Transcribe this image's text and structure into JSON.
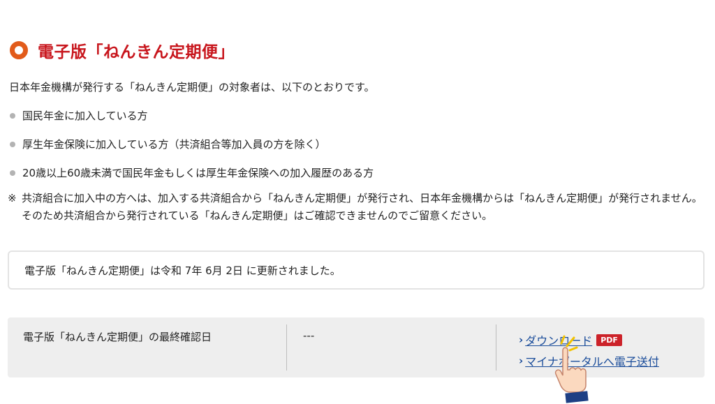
{
  "section": {
    "title": "電子版「ねんきん定期便」"
  },
  "intro": "日本年金機構が発行する「ねんきん定期便」の対象者は、以下のとおりです。",
  "bullets": [
    "国民年金に加入している方",
    "厚生年金保険に加入している方（共済組合等加入員の方を除く）",
    "20歳以上60歳未満で国民年金もしくは厚生年金保険への加入履歴のある方"
  ],
  "note": {
    "mark": "※",
    "text": "共済組合に加入中の方へは、加入する共済組合から「ねんきん定期便」が発行され、日本年金機構からは「ねんきん定期便」が発行されません。そのため共済組合から発行されている「ねんきん定期便」はご確認できませんのでご留意ください。"
  },
  "update_notice": "電子版「ねんきん定期便」は令和 7年 6月 2日 に更新されました。",
  "info_panel": {
    "label": "電子版「ねんきん定期便」の最終確認日",
    "value": "---",
    "links": {
      "download": "ダウンロード",
      "pdf_badge": "PDF",
      "send_to_portal": "マイナポータルへ電子送付"
    }
  },
  "icons": {
    "heading": "orange-ring-icon",
    "link_chevron": "chevron-right-icon",
    "pointer": "pointing-hand-icon"
  },
  "colors": {
    "heading_text": "#c8161d",
    "ring": "#e25b1a",
    "link": "#1a4c9a",
    "pdf_badge": "#cc2229",
    "panel_bg": "#eeeeee"
  }
}
